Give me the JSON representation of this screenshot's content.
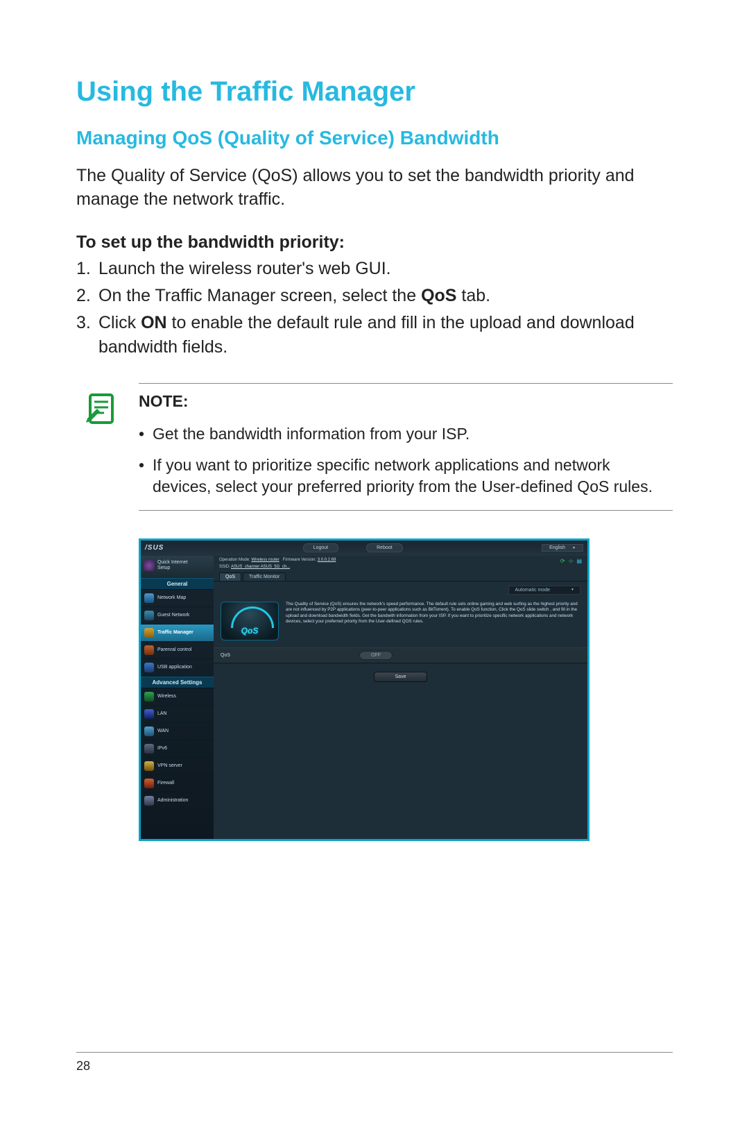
{
  "page_number": "28",
  "title": "Using the Traffic Manager",
  "subtitle": "Managing QoS (Quality of Service) Bandwidth",
  "intro": "The Quality of Service (QoS) allows you to set the bandwidth priority and manage the network traffic.",
  "steps_heading": "To set up the bandwidth priority:",
  "steps": [
    {
      "n": "1.",
      "text": "Launch the wireless router's web GUI."
    },
    {
      "n": "2.",
      "pre": "On the Traffic Manager screen, select the ",
      "bold": "QoS",
      "post": " tab."
    },
    {
      "n": "3.",
      "pre": "Click ",
      "bold": "ON",
      "post": " to enable the default rule and fill in the upload and download bandwidth fields."
    }
  ],
  "note_label": "NOTE:",
  "notes": [
    "Get the bandwidth information from your ISP.",
    "If you want to prioritize specific network applications and network devices, select your preferred priority from the User-defined QoS rules."
  ],
  "router": {
    "brand": "/SUS",
    "top_buttons": [
      "Logout",
      "Reboot"
    ],
    "language": "English",
    "quick_setup": "Quick Internet\nSetup",
    "section_general": "General",
    "section_advanced": "Advanced Settings",
    "menu_general": [
      "Network Map",
      "Guest Network",
      "Traffic Manager",
      "Parenral control",
      "USB application"
    ],
    "menu_advanced": [
      "Wireless",
      "LAN",
      "WAN",
      "IPv6",
      "VPN server",
      "Firewall",
      "Administration"
    ],
    "info_mode_label": "Operation Mode: ",
    "info_mode_value": "Wireless router",
    "info_fw_label": "Firmware Version: ",
    "info_fw_value": "3.0.0.2.69",
    "info_ssid_label": "SSID: ",
    "info_ssid_value": "ASUS_channer  ASUS_5G_ch...",
    "tabs": [
      "QoS",
      "Traffic Monitor"
    ],
    "mode_select": "Automatic mode",
    "qos_badge": "QoS",
    "qos_desc": "The Quality of Service (QoS) ensures the network's speed performance. The default rule sets online gaming and web surfing as the highest priority and are not influenced by P2P applications (peer-to-peer applications such as BitTorrent). To enable QoS function, Click the QoS slide switch , and fill in the upload and download bandwidth fields. Get the bandwith information from your ISP. If you want to prioritize specific network applications and network devices, select your preferred priority from the User-defined QOS rules.",
    "qos_label": "QoS",
    "qos_toggle": "OFF",
    "save": "Save"
  }
}
